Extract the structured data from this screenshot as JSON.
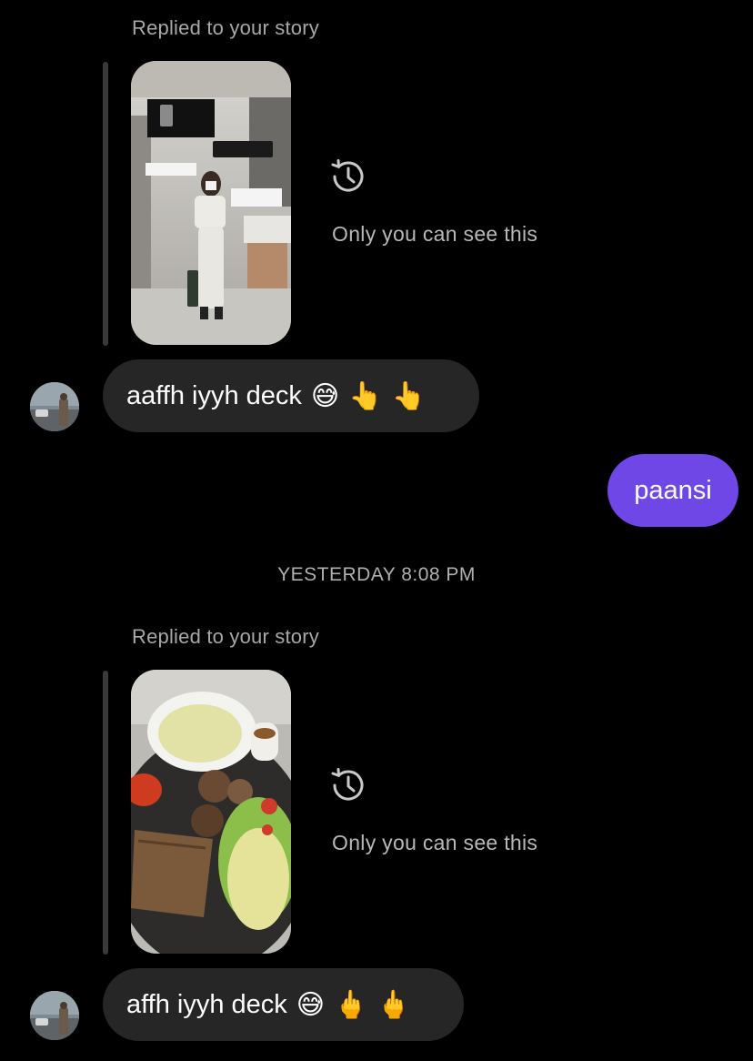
{
  "conversation": {
    "accent_color": "#6e47e6",
    "incoming_bubble_color": "#262626",
    "groups": [
      {
        "reply_label": "Replied to your story",
        "story_thumbnail": "story-photo-mirror-selfie",
        "expired_icon": "story-expired-history-icon",
        "expired_note": "Only you can see this",
        "message_text": "aaffh iyyh deck",
        "message_emoji": "😅👆👆",
        "avatar_icon": "sender-avatar"
      },
      {
        "reply_label": "Replied to your story",
        "story_thumbnail": "story-photo-food-plate",
        "expired_icon": "story-expired-history-icon",
        "expired_note": "Only you can see this",
        "message_text": "affh iyyh deck",
        "message_emoji": "😅🖕🖕",
        "avatar_icon": "sender-avatar"
      }
    ],
    "outgoing": {
      "message_text": "paansi"
    },
    "timestamp_divider": "YESTERDAY 8:08 PM"
  }
}
